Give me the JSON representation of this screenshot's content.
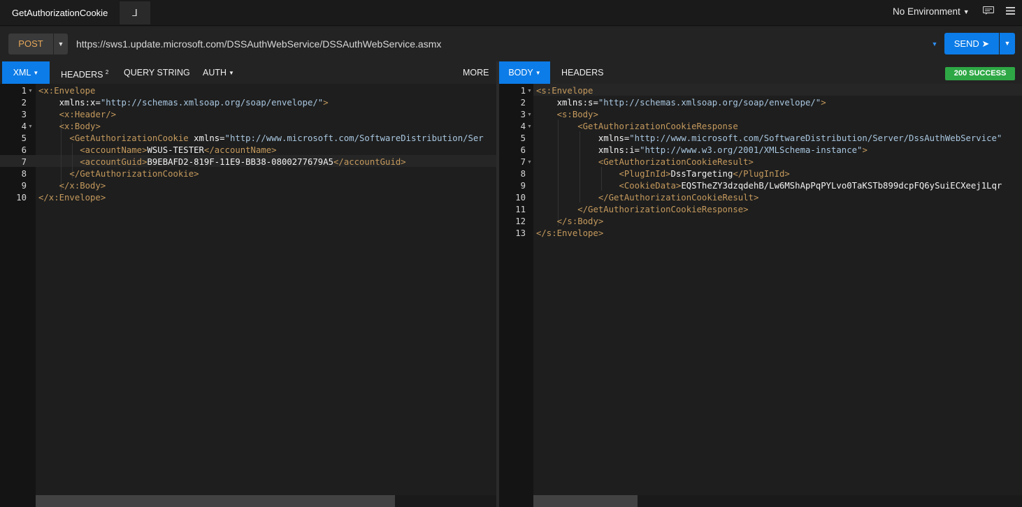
{
  "top": {
    "tab_title": "GetAuthorizationCookie",
    "tab_icon": "⅃",
    "environment": "No Environment"
  },
  "request": {
    "method": "POST",
    "url": "https://sws1.update.microsoft.com/DSSAuthWebService/DSSAuthWebService.asmx",
    "send_label": "SEND ➤"
  },
  "request_tabs": {
    "xml": "XML",
    "headers": "HEADERS",
    "headers_count": "2",
    "query_string": "QUERY STRING",
    "auth": "AUTH",
    "more": "MORE"
  },
  "response_tabs": {
    "body": "BODY",
    "headers": "HEADERS",
    "status": "200 SUCCESS"
  },
  "colors": {
    "accent": "#0c7ce8",
    "success": "#2ea845",
    "method": "#e7a85a",
    "tag": "#c59a5d",
    "string": "#a9c7e0"
  },
  "request_body": [
    {
      "n": "1",
      "segs": [
        [
          "t",
          "<x:Envelope"
        ]
      ]
    },
    {
      "n": "2",
      "segs": [
        [
          "x",
          "    "
        ],
        [
          "a",
          "xmlns:x"
        ],
        [
          "x",
          "="
        ],
        [
          "s",
          "\"http://schemas.xmlsoap.org/soap/envelope/\""
        ],
        [
          "t",
          ">"
        ]
      ]
    },
    {
      "n": "3",
      "segs": [
        [
          "x",
          "    "
        ],
        [
          "t",
          "<x:Header/>"
        ]
      ]
    },
    {
      "n": "4",
      "segs": [
        [
          "x",
          "    "
        ],
        [
          "t",
          "<x:Body>"
        ]
      ]
    },
    {
      "n": "5",
      "segs": [
        [
          "x",
          "      "
        ],
        [
          "t",
          "<GetAuthorizationCookie "
        ],
        [
          "a",
          "xmlns"
        ],
        [
          "x",
          "="
        ],
        [
          "s",
          "\"http://www.microsoft.com/SoftwareDistribution/Ser"
        ]
      ]
    },
    {
      "n": "6",
      "segs": [
        [
          "x",
          "        "
        ],
        [
          "t",
          "<accountName>"
        ],
        [
          "a",
          "WSUS-TESTER"
        ],
        [
          "t",
          "</accountName>"
        ]
      ]
    },
    {
      "n": "7",
      "segs": [
        [
          "x",
          "        "
        ],
        [
          "t",
          "<accountGuid>"
        ],
        [
          "a",
          "B9EBAFD2-819F-11E9-BB38-0800277679A5"
        ],
        [
          "t",
          "</accountGuid>"
        ]
      ]
    },
    {
      "n": "8",
      "segs": [
        [
          "x",
          "      "
        ],
        [
          "t",
          "</GetAuthorizationCookie>"
        ]
      ]
    },
    {
      "n": "9",
      "segs": [
        [
          "x",
          "    "
        ],
        [
          "t",
          "</x:Body>"
        ]
      ]
    },
    {
      "n": "10",
      "segs": [
        [
          "t",
          "</x:Envelope>"
        ]
      ]
    }
  ],
  "response_body": [
    {
      "n": "1",
      "segs": [
        [
          "t",
          "<s:Envelope"
        ]
      ]
    },
    {
      "n": "2",
      "segs": [
        [
          "x",
          "    "
        ],
        [
          "a",
          "xmlns:s"
        ],
        [
          "x",
          "="
        ],
        [
          "s",
          "\"http://schemas.xmlsoap.org/soap/envelope/\""
        ],
        [
          "t",
          ">"
        ]
      ]
    },
    {
      "n": "3",
      "segs": [
        [
          "x",
          "    "
        ],
        [
          "t",
          "<s:Body>"
        ]
      ]
    },
    {
      "n": "4",
      "segs": [
        [
          "x",
          "        "
        ],
        [
          "t",
          "<GetAuthorizationCookieResponse"
        ]
      ]
    },
    {
      "n": "5",
      "segs": [
        [
          "x",
          "            "
        ],
        [
          "a",
          "xmlns"
        ],
        [
          "x",
          "="
        ],
        [
          "s",
          "\"http://www.microsoft.com/SoftwareDistribution/Server/DssAuthWebService\""
        ]
      ]
    },
    {
      "n": "6",
      "segs": [
        [
          "x",
          "            "
        ],
        [
          "a",
          "xmlns:i"
        ],
        [
          "x",
          "="
        ],
        [
          "s",
          "\"http://www.w3.org/2001/XMLSchema-instance\""
        ],
        [
          "t",
          ">"
        ]
      ]
    },
    {
      "n": "7",
      "segs": [
        [
          "x",
          "            "
        ],
        [
          "t",
          "<GetAuthorizationCookieResult>"
        ]
      ]
    },
    {
      "n": "8",
      "segs": [
        [
          "x",
          "                "
        ],
        [
          "t",
          "<PlugInId>"
        ],
        [
          "a",
          "DssTargeting"
        ],
        [
          "t",
          "</PlugInId>"
        ]
      ]
    },
    {
      "n": "9",
      "segs": [
        [
          "x",
          "                "
        ],
        [
          "t",
          "<CookieData>"
        ],
        [
          "a",
          "EQSTheZY3dzqdehB/Lw6MShApPqPYLvo0TaKSTb899dcpFQ6ySuiECXeej1Lqr"
        ]
      ]
    },
    {
      "n": "10",
      "segs": [
        [
          "x",
          "            "
        ],
        [
          "t",
          "</GetAuthorizationCookieResult>"
        ]
      ]
    },
    {
      "n": "11",
      "segs": [
        [
          "x",
          "        "
        ],
        [
          "t",
          "</GetAuthorizationCookieResponse>"
        ]
      ]
    },
    {
      "n": "12",
      "segs": [
        [
          "x",
          "    "
        ],
        [
          "t",
          "</s:Body>"
        ]
      ]
    },
    {
      "n": "13",
      "segs": [
        [
          "t",
          "</s:Envelope>"
        ]
      ]
    }
  ]
}
